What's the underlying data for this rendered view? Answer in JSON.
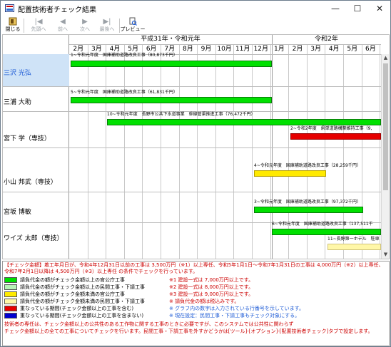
{
  "window": {
    "title": "配置技術者チェック結果",
    "minimize": "—",
    "maximize": "☐",
    "close": "✕"
  },
  "toolbar": {
    "buttons": [
      {
        "label": "閉じる",
        "icon": "close-icon",
        "enabled": true
      },
      {
        "label": "先頭へ",
        "icon": "first-icon",
        "enabled": false
      },
      {
        "label": "前へ",
        "icon": "prev-icon",
        "enabled": false
      },
      {
        "label": "次へ",
        "icon": "next-icon",
        "enabled": false
      },
      {
        "label": "最後へ",
        "icon": "last-icon",
        "enabled": false
      },
      {
        "label": "プレビュー",
        "icon": "preview-icon",
        "enabled": true
      }
    ]
  },
  "timeline": {
    "eras": [
      "平成31年・令和元年",
      "令和2年"
    ],
    "months": [
      "2月",
      "3月",
      "4月",
      "5月",
      "6月",
      "7月",
      "8月",
      "9月",
      "10月",
      "11月",
      "12月",
      "1月",
      "2月",
      "3月",
      "4月",
      "5月",
      "6月"
    ]
  },
  "people": [
    {
      "name": "三沢 光弘",
      "selected": true
    },
    {
      "name": "三浦 大助",
      "selected": false
    },
    {
      "name": "宮下 学（専技）",
      "selected": false
    },
    {
      "name": "小山 邦武（専技）",
      "selected": false
    },
    {
      "name": "宮坂 博敏",
      "selected": false
    },
    {
      "name": "ワイズ 太郎（専技）",
      "selected": false
    }
  ],
  "jobs": [
    {
      "label": "1~令和元年度　国庫補助道路改良工事（80,873千円）",
      "color": "green"
    },
    {
      "label": "5~令和元年度　国庫補助道路改良工事（61,831千円）",
      "color": "green"
    },
    {
      "label": "10~令和元年度　長野市公共下水道事業　幹線管渠推進工事（76,472千円）",
      "color": "green"
    },
    {
      "label": "2~令和2年度　県単道路構築維持工事（9,",
      "color": "red"
    },
    {
      "label": "4~令和元年度　国庫補助道路改良工事（28,259千円）",
      "color": "yellow"
    },
    {
      "label": "3~令和元年度　国庫補助道路改良工事（97,372千円）",
      "color": "green"
    },
    {
      "label": "6~令和元年度　国庫補助道路改良工事（137,511千",
      "color": "green"
    },
    {
      "label": "11~長野第一ホテル　駐車",
      "color": "paleyellow"
    }
  ],
  "notes": {
    "header": "【チェック金額】着工年月日が、令和4年12月31日以前の工事は 3,500万円（※1）以上専任、令和5年1月1日～令和7年1月31日の工事は 4,000万円（※2）以上専任、令和7年2月1日以降は 4,500万円（※3）以上専任 の条件でチェックを行っています。",
    "legend": [
      {
        "text": "請負代金の額がチェック金額以上の官公庁工事",
        "color": "#00e000"
      },
      {
        "text": "請負代金の額がチェック金額以上の民間工事・下請工事",
        "color": "#b7f2b7"
      },
      {
        "text": "請負代金の額がチェック金額未満の官公庁工事",
        "color": "#ffea00"
      },
      {
        "text": "請負代金の額がチェック金額未満の民間工事・下請工事",
        "color": "#fff7a8"
      },
      {
        "text": "重なっている期間(チェック金額以上の工事を含む)",
        "color": "#e60000"
      },
      {
        "text": "重なっている期間(チェック金額以上の工事を含まない)",
        "color": "#0000d0"
      }
    ],
    "side": [
      {
        "text": "※1 建設一式は 7,000万円以上です。",
        "tone": "red"
      },
      {
        "text": "※2 建設一式は 8,000万円以上です。",
        "tone": "red"
      },
      {
        "text": "※3 建設一式は 9,000万円以上です。",
        "tone": "red"
      },
      {
        "text": "※ 請負代金の額は税込みです。",
        "tone": "red"
      },
      {
        "text": "※ グラフ内の数字は入力されている行番号を示しています。",
        "tone": "blue"
      },
      {
        "text": "※ 現在設定：民間工事・下請工事もチェック対象にする。",
        "tone": "blue"
      }
    ],
    "footer1": "技術者の専任は、チェック金額以上の公共性のある工作物に関する工事のときに必要ですが、このシステムでは公共性に関わらず",
    "footer2": "チェック金額以上の全ての工事についてチェックを行います。民間工事・下請工事を外すかどうかは[ツール]-[オプション]-[配置技術者チェック]タブで設定します。"
  }
}
